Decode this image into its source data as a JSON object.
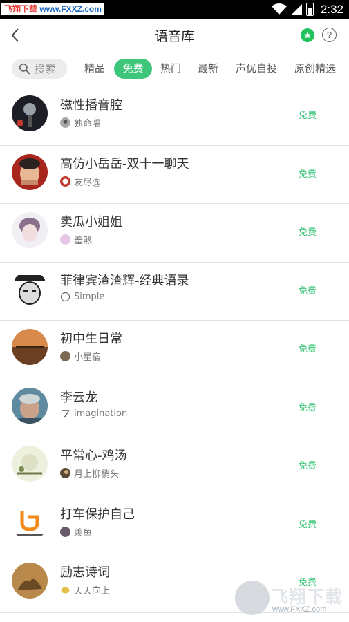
{
  "status_bar": {
    "watermark_prefix": "飞翔下载",
    "watermark_url": "www.FXXZ.com",
    "time": "2:32"
  },
  "header": {
    "title": "语音库",
    "help_symbol": "?"
  },
  "search": {
    "label": "搜索"
  },
  "tabs": [
    {
      "label": "精品",
      "active": false
    },
    {
      "label": "免费",
      "active": true
    },
    {
      "label": "热门",
      "active": false
    },
    {
      "label": "最新",
      "active": false
    },
    {
      "label": "声优自投",
      "active": false
    },
    {
      "label": "原创精选",
      "active": false
    }
  ],
  "items": [
    {
      "title": "磁性播音腔",
      "author": "独命唱",
      "price": "免费"
    },
    {
      "title": "高仿小岳岳-双十一聊天",
      "author": "友尽@",
      "price": "免费"
    },
    {
      "title": "卖瓜小姐姐",
      "author": "羞煞",
      "price": "免费"
    },
    {
      "title": "菲律宾渣渣辉-经典语录",
      "author": "Simple",
      "price": "免费"
    },
    {
      "title": "初中生日常",
      "author": "小星宿",
      "price": "免费"
    },
    {
      "title": "李云龙",
      "author": "imagination",
      "price": "免费"
    },
    {
      "title": "平常心-鸡汤",
      "author": "月上柳梢头",
      "price": "免费"
    },
    {
      "title": "打车保护自己",
      "author": "羡鱼",
      "price": "免费"
    },
    {
      "title": "励志诗词",
      "author": "天天向上",
      "price": "免费"
    }
  ],
  "watermark_bottom": {
    "brand": "飞翔下载",
    "url": "www.FXXZ.com"
  },
  "colors": {
    "accent": "#3ec67b",
    "status_bar": "#000000"
  }
}
